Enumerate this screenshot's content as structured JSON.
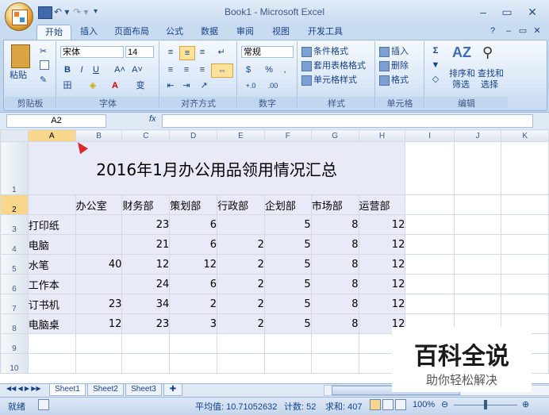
{
  "window": {
    "title": "Book1 - Microsoft Excel",
    "min": "–",
    "max": "▭",
    "close": "✕",
    "ribbon_help": "?",
    "ribbon_min": "–",
    "ribbon_restore": "▭",
    "ribbon_close": "✕"
  },
  "qat": {
    "undo": "↶ ▾",
    "redo": "↷ ▾",
    "more": "▾"
  },
  "tabs": [
    "开始",
    "插入",
    "页面布局",
    "公式",
    "数据",
    "审阅",
    "视图",
    "开发工具"
  ],
  "ribbon": {
    "clipboard": {
      "label": "剪贴板",
      "paste": "粘贴"
    },
    "font": {
      "label": "字体",
      "name": "宋体",
      "size": "14",
      "bold": "B",
      "italic": "I",
      "underline": "U",
      "grow": "A˄",
      "shrink": "A˅",
      "border": "田",
      "fill": "◈",
      "color": "A",
      "phonetic": "变"
    },
    "align": {
      "label": "对齐方式"
    },
    "number": {
      "label": "数字",
      "format": "常规",
      "percent": "%",
      "comma": ",",
      "inc": "+.0",
      "dec": ".00"
    },
    "styles": {
      "label": "样式",
      "cond": "条件格式",
      "table": "套用表格格式",
      "cell": "单元格样式"
    },
    "cells": {
      "label": "单元格",
      "insert": "插入",
      "delete": "删除",
      "format": "格式"
    },
    "editing": {
      "label": "编辑",
      "sum": "Σ",
      "sort": "排序和",
      "sort2": "筛选",
      "find": "查找和",
      "find2": "选择"
    }
  },
  "formula": {
    "namebox": "A2",
    "fx": "fx"
  },
  "columns": [
    "A",
    "B",
    "C",
    "D",
    "E",
    "F",
    "G",
    "H",
    "I",
    "J",
    "K"
  ],
  "rows": [
    "1",
    "2",
    "3",
    "4",
    "5",
    "6",
    "7",
    "8",
    "9",
    "10"
  ],
  "table": {
    "title": "2016年1月办公用品领用情况汇总",
    "headers": [
      "",
      "办公室",
      "财务部",
      "策划部",
      "行政部",
      "企划部",
      "市场部",
      "运营部"
    ],
    "data": [
      [
        "打印纸",
        "",
        "23",
        "6",
        "",
        "5",
        "8",
        "12"
      ],
      [
        "电脑",
        "",
        "21",
        "6",
        "2",
        "5",
        "8",
        "12"
      ],
      [
        "水笔",
        "40",
        "12",
        "12",
        "2",
        "5",
        "8",
        "12"
      ],
      [
        "工作本",
        "",
        "24",
        "6",
        "2",
        "5",
        "8",
        "12"
      ],
      [
        "订书机",
        "23",
        "34",
        "2",
        "2",
        "5",
        "8",
        "12"
      ],
      [
        "电脑桌",
        "12",
        "23",
        "3",
        "2",
        "5",
        "8",
        "12"
      ]
    ]
  },
  "sheets": [
    "Sheet1",
    "Sheet2",
    "Sheet3"
  ],
  "status": {
    "ready": "就绪",
    "average": "平均值: 10.71052632",
    "count": "计数: 52",
    "sum": "求和: 407",
    "zoom": "100%"
  },
  "watermark": {
    "title": "百科全说",
    "subtitle": "助你轻松解决"
  }
}
